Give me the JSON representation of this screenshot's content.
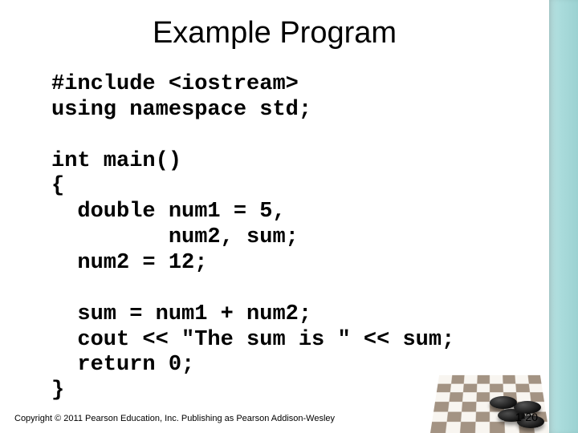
{
  "title": "Example Program",
  "code": "#include <iostream>\nusing namespace std;\n\nint main()\n{\n  double num1 = 5,\n         num2, sum;\n  num2 = 12;\n\n  sum = num1 + num2;\n  cout << \"The sum is \" << sum;\n  return 0;\n}",
  "footer": "Copyright © 2011 Pearson Education, Inc. Publishing as Pearson Addison-Wesley",
  "page_number": "1-20",
  "decor": {
    "image_desc": "checkers-board-with-black-pieces"
  }
}
